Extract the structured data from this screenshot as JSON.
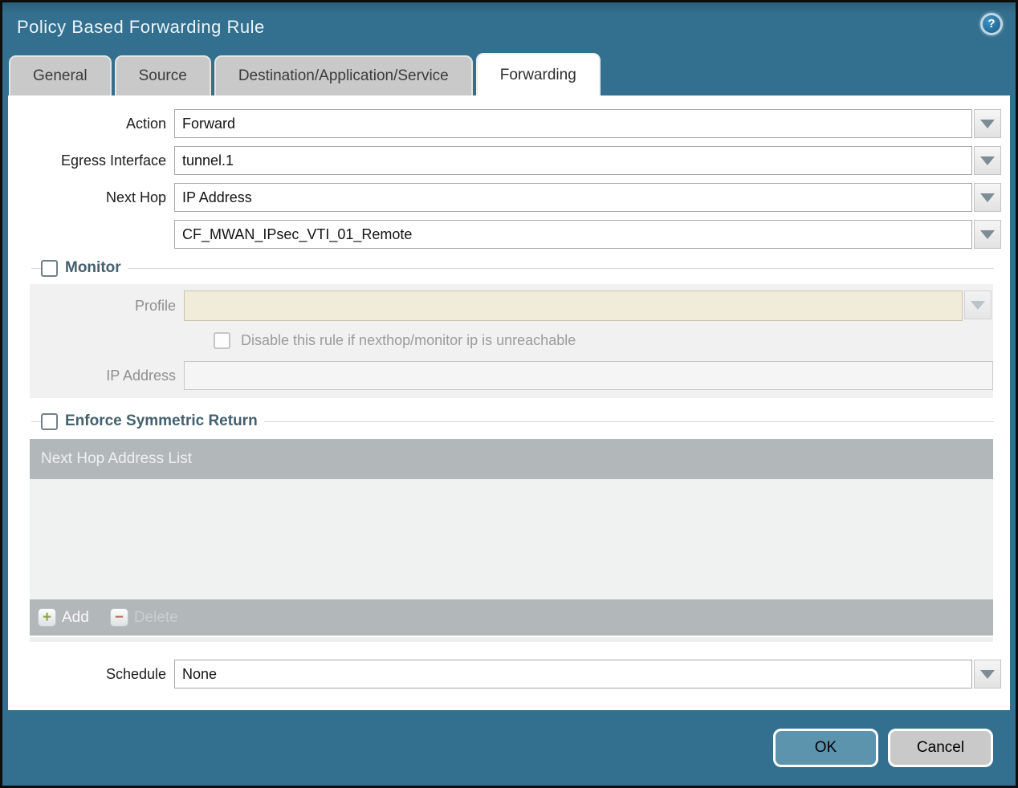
{
  "dialog": {
    "title": "Policy Based Forwarding Rule"
  },
  "icons": {
    "help": "?",
    "plus": "+",
    "minus": "−"
  },
  "tabs": [
    {
      "label": "General",
      "active": false
    },
    {
      "label": "Source",
      "active": false
    },
    {
      "label": "Destination/Application/Service",
      "active": false
    },
    {
      "label": "Forwarding",
      "active": true
    }
  ],
  "form": {
    "action": {
      "label": "Action",
      "value": "Forward"
    },
    "egress_interface": {
      "label": "Egress Interface",
      "value": "tunnel.1"
    },
    "next_hop": {
      "label": "Next Hop",
      "value": "IP Address"
    },
    "next_hop_address": {
      "value": "CF_MWAN_IPsec_VTI_01_Remote"
    },
    "schedule": {
      "label": "Schedule",
      "value": "None"
    }
  },
  "monitor": {
    "label": "Monitor",
    "checked": false,
    "profile": {
      "label": "Profile",
      "value": ""
    },
    "disable_rule": {
      "label": "Disable this rule if nexthop/monitor ip is unreachable",
      "checked": false
    },
    "ip_address": {
      "label": "IP Address",
      "value": ""
    }
  },
  "enforce_symmetric_return": {
    "label": "Enforce Symmetric Return",
    "checked": false,
    "table": {
      "header": "Next Hop Address List",
      "rows": [],
      "add_label": "Add",
      "delete_label": "Delete"
    }
  },
  "footer": {
    "ok_label": "OK",
    "cancel_label": "Cancel"
  },
  "colors": {
    "titlebar_teal": "#336f8e",
    "ok_button": "#5d94ad",
    "cream_field": "#f1ebd9",
    "section_heading": "#44606e",
    "table_bar": "#b2b7ba",
    "tab_inactive": "#c9c9c9"
  }
}
